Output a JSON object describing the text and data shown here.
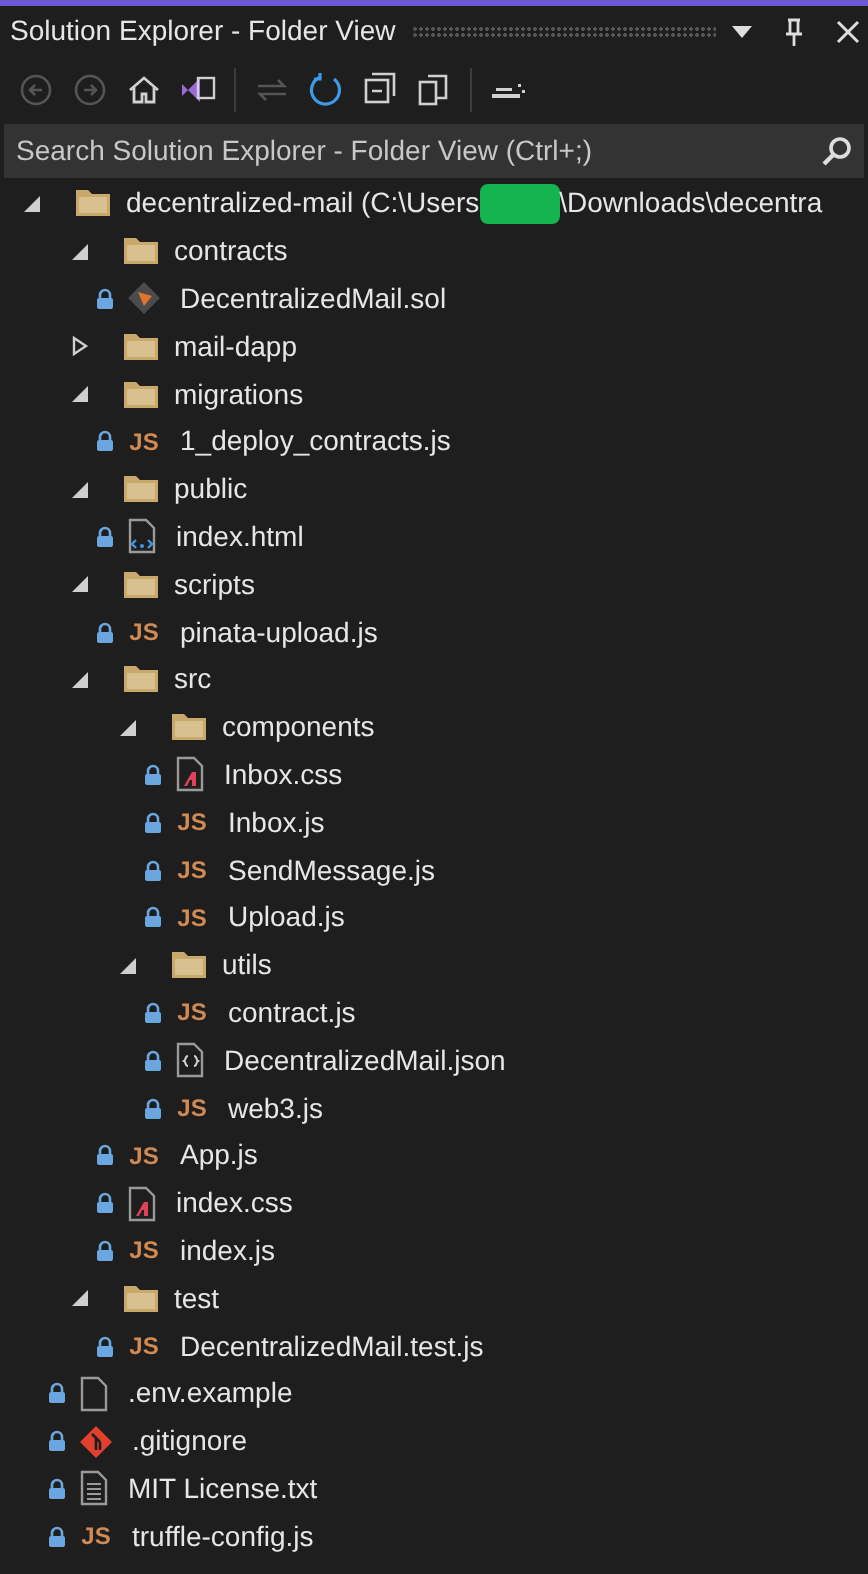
{
  "panel": {
    "title": "Solution Explorer - Folder View"
  },
  "toolbar": [
    {
      "kind": "back",
      "disabled": true
    },
    {
      "kind": "forward",
      "disabled": true
    },
    {
      "kind": "home",
      "disabled": false
    },
    {
      "kind": "solution",
      "disabled": false
    },
    {
      "kind": "sync",
      "disabled": true
    },
    {
      "kind": "refresh",
      "disabled": false
    },
    {
      "kind": "collapse",
      "disabled": false
    },
    {
      "kind": "copy",
      "disabled": false
    },
    {
      "kind": "preview",
      "disabled": false
    }
  ],
  "search": {
    "placeholder": "Search Solution Explorer - Folder View (Ctrl+;)"
  },
  "tree": [
    {
      "kind": "folder",
      "label": "decentralized-mail (C:\\Users",
      "redacted": true,
      "label_after": "\\Downloads\\decentra",
      "expanded": true,
      "children": [
        {
          "kind": "folder",
          "label": "contracts",
          "expanded": true,
          "children": [
            {
              "kind": "sol",
              "label": "DecentralizedMail.sol"
            }
          ]
        },
        {
          "kind": "folder",
          "label": "mail-dapp",
          "expanded": false
        },
        {
          "kind": "folder",
          "label": "migrations",
          "expanded": true,
          "children": [
            {
              "kind": "js",
              "icon_text": "JS",
              "label": "1_deploy_contracts.js"
            }
          ]
        },
        {
          "kind": "folder",
          "label": "public",
          "expanded": true,
          "children": [
            {
              "kind": "html",
              "label": "index.html"
            }
          ]
        },
        {
          "kind": "folder",
          "label": "scripts",
          "expanded": true,
          "children": [
            {
              "kind": "js",
              "icon_text": "JS",
              "label": "pinata-upload.js"
            }
          ]
        },
        {
          "kind": "folder",
          "label": "src",
          "expanded": true,
          "children": [
            {
              "kind": "folder",
              "label": "components",
              "expanded": true,
              "children": [
                {
                  "kind": "css",
                  "label": "Inbox.css"
                },
                {
                  "kind": "js",
                  "icon_text": "JS",
                  "label": "Inbox.js"
                },
                {
                  "kind": "js",
                  "icon_text": "JS",
                  "label": "SendMessage.js"
                },
                {
                  "kind": "js",
                  "icon_text": "JS",
                  "label": "Upload.js"
                }
              ]
            },
            {
              "kind": "folder",
              "label": "utils",
              "expanded": true,
              "children": [
                {
                  "kind": "js",
                  "icon_text": "JS",
                  "label": "contract.js"
                },
                {
                  "kind": "json",
                  "label": "DecentralizedMail.json"
                },
                {
                  "kind": "js",
                  "icon_text": "JS",
                  "label": "web3.js"
                }
              ]
            },
            {
              "kind": "js",
              "icon_text": "JS",
              "label": "App.js"
            },
            {
              "kind": "css",
              "label": "index.css"
            },
            {
              "kind": "js",
              "icon_text": "JS",
              "label": "index.js"
            }
          ]
        },
        {
          "kind": "folder",
          "label": "test",
          "expanded": true,
          "children": [
            {
              "kind": "js",
              "icon_text": "JS",
              "label": "DecentralizedMail.test.js"
            }
          ]
        },
        {
          "kind": "file",
          "label": ".env.example"
        },
        {
          "kind": "git",
          "label": ".gitignore"
        },
        {
          "kind": "txt",
          "label": "MIT License.txt"
        },
        {
          "kind": "js",
          "icon_text": "JS",
          "label": "truffle-config.js"
        }
      ]
    }
  ]
}
